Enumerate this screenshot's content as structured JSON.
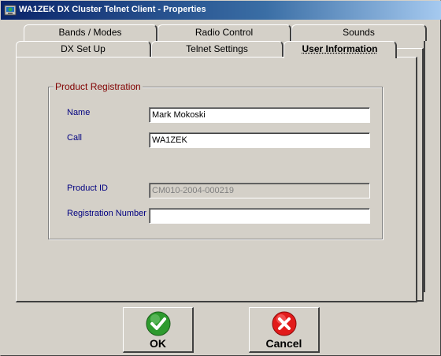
{
  "window": {
    "title": "WA1ZEK DX Cluster Telnet Client - Properties"
  },
  "tabs": {
    "back_row": [
      {
        "label": "Bands / Modes"
      },
      {
        "label": "Radio Control"
      },
      {
        "label": "Sounds"
      }
    ],
    "front_row": [
      {
        "label": "DX Set Up"
      },
      {
        "label": "Telnet Settings"
      },
      {
        "label": "User Information",
        "active": true
      }
    ]
  },
  "registration": {
    "legend": "Product Registration",
    "name_label": "Name",
    "name_value": "Mark Mokoski",
    "call_label": "Call",
    "call_value": "WA1ZEK",
    "product_id_label": "Product ID",
    "product_id_value": "CM010-2004-000219",
    "reg_number_label": "Registration Number",
    "reg_number_value": ""
  },
  "buttons": {
    "ok_label": "OK",
    "cancel_label": "Cancel"
  },
  "colors": {
    "ok_icon": "#2e9a2e",
    "cancel_icon": "#e21b1b",
    "label_text": "#000080",
    "legend_text": "#800000"
  },
  "icons": {
    "app": "network-globe-icon",
    "ok": "checkmark-icon",
    "cancel": "x-cross-icon"
  }
}
